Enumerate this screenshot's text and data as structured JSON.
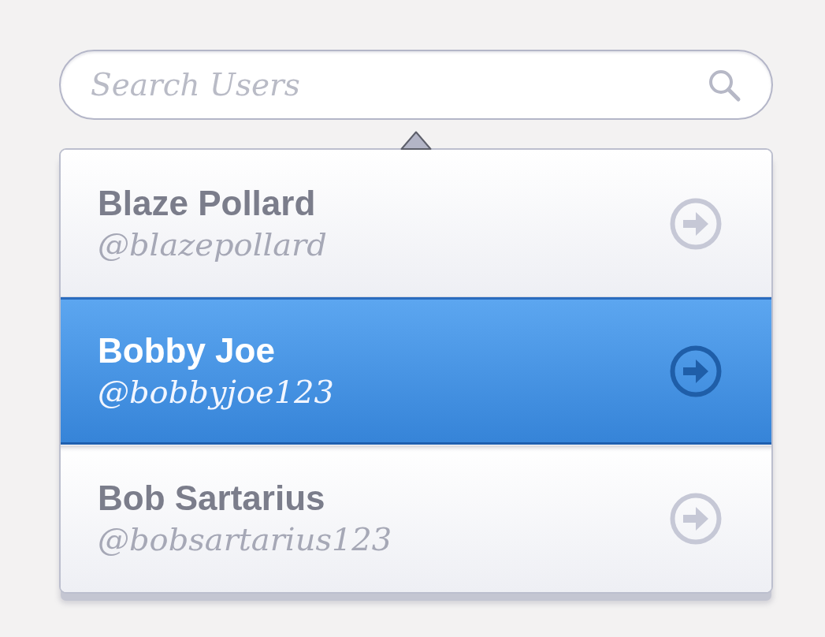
{
  "search": {
    "placeholder": "Search Users"
  },
  "users": [
    {
      "name": "Blaze Pollard",
      "handle": "@blazepollard",
      "selected": false
    },
    {
      "name": "Bobby Joe",
      "handle": "@bobbyjoe123",
      "selected": true
    },
    {
      "name": "Bob Sartarius",
      "handle": "@bobsartarius123",
      "selected": false
    }
  ]
}
